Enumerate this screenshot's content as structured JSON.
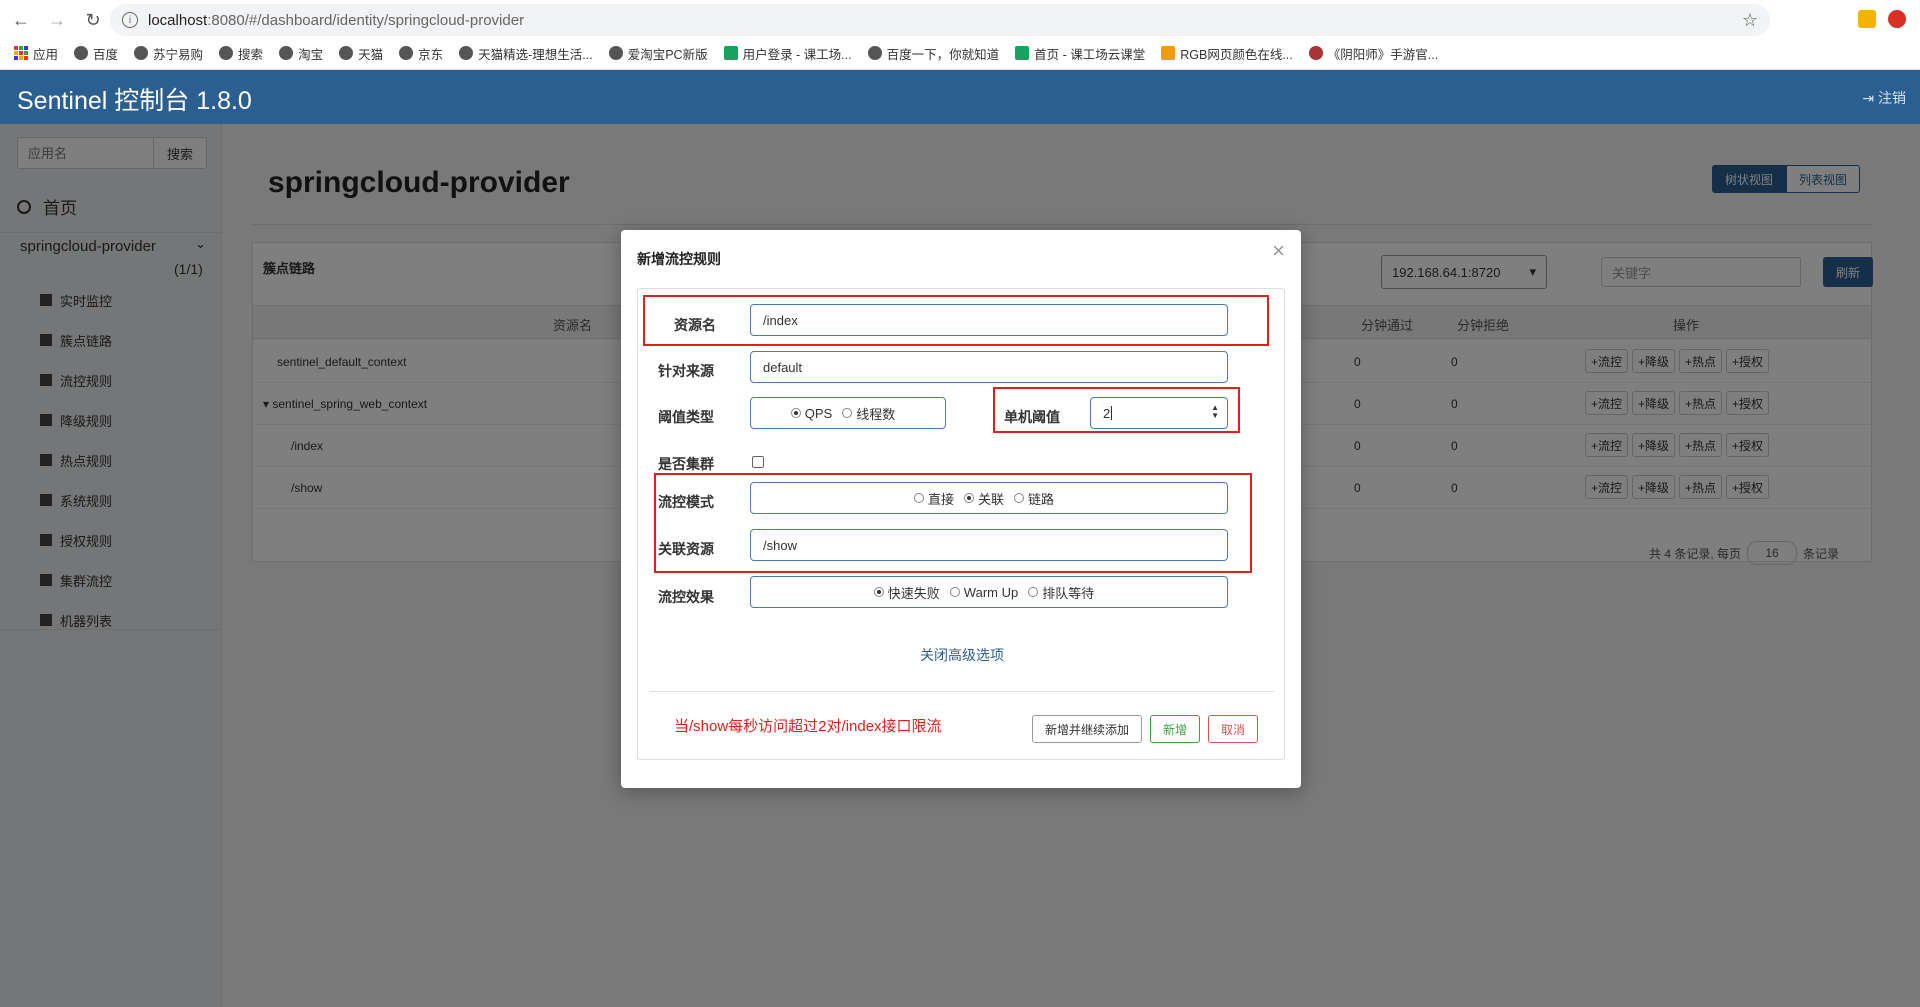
{
  "browser": {
    "url_host": "localhost",
    "url_path": ":8080/#/dashboard/identity/springcloud-provider",
    "bookmarks": [
      "应用",
      "百度",
      "苏宁易购",
      "搜索",
      "淘宝",
      "天猫",
      "京东",
      "天猫精选-理想生活...",
      "爱淘宝PC新版",
      "用户登录 - 课工场...",
      "百度一下，你就知道",
      "首页 - 课工场云课堂",
      "RGB网页颜色在线...",
      "《阴阳师》手游官..."
    ]
  },
  "header": {
    "brand": "Sentinel 控制台 1.8.0",
    "logout": "注销"
  },
  "sidebar": {
    "search_placeholder": "应用名",
    "search_button": "搜索",
    "home": "首页",
    "app_name": "springcloud-provider",
    "app_count": "(1/1)",
    "items": [
      "实时监控",
      "簇点链路",
      "流控规则",
      "降级规则",
      "热点规则",
      "系统规则",
      "授权规则",
      "集群流控",
      "机器列表"
    ]
  },
  "page": {
    "title": "springcloud-provider",
    "view_tree": "树状视图",
    "view_list": "列表视图",
    "panel_title": "簇点链路",
    "machine": "192.168.64.1:8720",
    "keyword_placeholder": "关键字",
    "refresh": "刷新",
    "columns": {
      "resource": "资源名",
      "pass": "分钟通过",
      "block": "分钟拒绝",
      "ops": "操作"
    },
    "rows": [
      {
        "name": "sentinel_default_context",
        "pass": "0",
        "block": "0"
      },
      {
        "name": "▾ sentinel_spring_web_context",
        "pass": "0",
        "block": "0"
      },
      {
        "name": "/index",
        "pass": "0",
        "block": "0"
      },
      {
        "name": "/show",
        "pass": "0",
        "block": "0"
      }
    ],
    "ops": [
      "+流控",
      "+降级",
      "+热点",
      "+授权"
    ],
    "pager_text": "共 4 条记录, 每页",
    "pager_size": "16",
    "pager_suffix": "条记录"
  },
  "modal": {
    "title": "新增流控规则",
    "close": "×",
    "resource_label": "资源名",
    "resource_value": "/index",
    "origin_label": "针对来源",
    "origin_value": "default",
    "grade_label": "阈值类型",
    "grade_options": [
      "QPS",
      "线程数"
    ],
    "threshold_label": "单机阈值",
    "threshold_value": "2",
    "cluster_label": "是否集群",
    "strategy_label": "流控模式",
    "strategy_options": [
      "直接",
      "关联",
      "链路"
    ],
    "ref_label": "关联资源",
    "ref_value": "/show",
    "effect_label": "流控效果",
    "effect_options": [
      "快速失败",
      "Warm Up",
      "排队等待"
    ],
    "advanced": "关闭高级选项",
    "annotation": "当/show每秒访问超过2对/index接口限流",
    "btn_add_continue": "新增并继续添加",
    "btn_add": "新增",
    "btn_cancel": "取消"
  },
  "colors": {
    "header": "#2b5f91",
    "annotation_red": "#e0201a",
    "add_green": "#3c9f3c",
    "cancel_red": "#d9534f"
  }
}
